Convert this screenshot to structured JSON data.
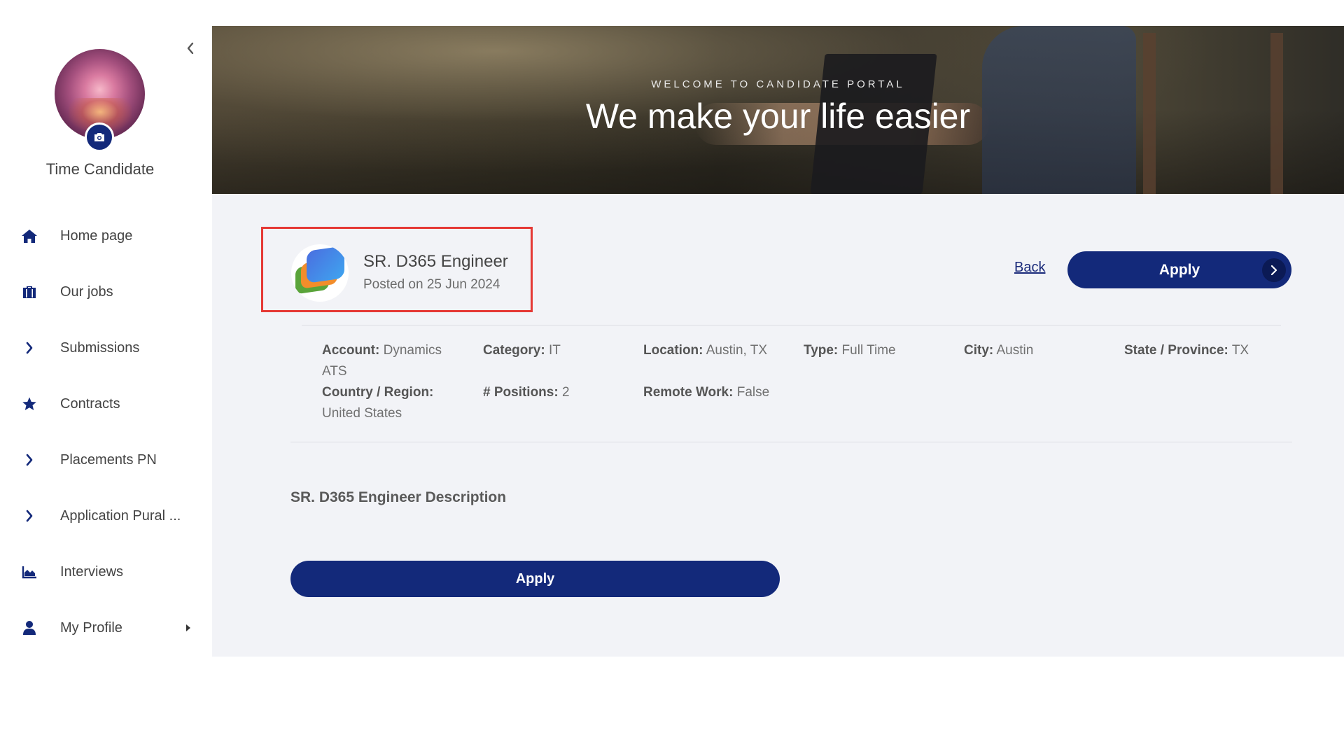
{
  "sidebar": {
    "user_name": "Time Candidate",
    "items": [
      {
        "label": "Home page",
        "icon": "home-icon"
      },
      {
        "label": "Our jobs",
        "icon": "briefcase-icon"
      },
      {
        "label": "Submissions",
        "icon": "chevron-right-icon"
      },
      {
        "label": "Contracts",
        "icon": "star-icon"
      },
      {
        "label": "Placements PN",
        "icon": "chevron-right-icon"
      },
      {
        "label": "Application Pural ...",
        "icon": "chevron-right-icon"
      },
      {
        "label": "Interviews",
        "icon": "area-chart-icon"
      },
      {
        "label": "My Profile",
        "icon": "user-icon",
        "has_submenu": true
      }
    ]
  },
  "hero": {
    "subtitle": "WELCOME TO CANDIDATE PORTAL",
    "title": "We make your life easier"
  },
  "job": {
    "title": "SR. D365 Engineer",
    "posted": "Posted on 25 Jun 2024",
    "back_label": "Back",
    "apply_label": "Apply",
    "fields": {
      "account_label": "Account:",
      "account_value": "Dynamics ATS",
      "category_label": "Category:",
      "category_value": "IT",
      "location_label": "Location:",
      "location_value": "Austin, TX",
      "type_label": "Type:",
      "type_value": "Full Time",
      "city_label": "City:",
      "city_value": "Austin",
      "state_label": "State / Province:",
      "state_value": "TX",
      "country_label": "Country / Region:",
      "country_value": "United States",
      "positions_label": "# Positions:",
      "positions_value": "2",
      "remote_label": "Remote Work:",
      "remote_value": "False"
    },
    "description_title": "SR. D365 Engineer Description",
    "apply_bottom_label": "Apply"
  },
  "colors": {
    "primary": "#13297a",
    "highlight_border": "#e53935",
    "main_bg": "#f2f3f7"
  }
}
